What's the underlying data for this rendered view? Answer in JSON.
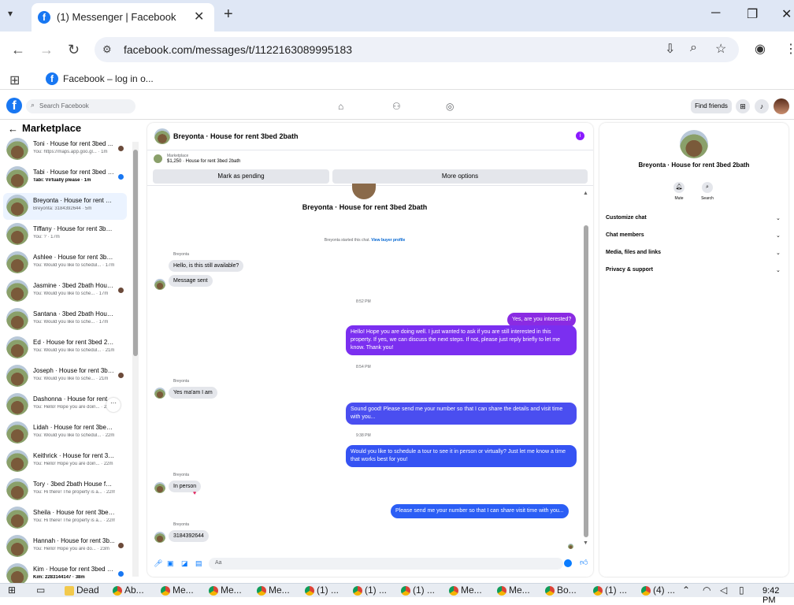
{
  "browser": {
    "tab_title": "(1) Messenger | Facebook",
    "url": "facebook.com/messages/t/1122163089995183",
    "bookmark": "Facebook – log in o..."
  },
  "fb": {
    "search_placeholder": "Search Facebook",
    "find_friends": "Find friends"
  },
  "left": {
    "title": "Marketplace",
    "conversations": [
      {
        "name": "Toni · House for rent 3bed ...",
        "preview": "You: https://maps.app.goo.gl... · 1m",
        "indicator": "avatar"
      },
      {
        "name": "Tabi · House for rent 3bed 2...",
        "preview": "Tabi: Virtually please · 1m",
        "indicator": "unread",
        "bold": true
      },
      {
        "name": "Breyonta · House for rent 3be...",
        "preview": "Breyonta: 3184392644 · 5m",
        "indicator": "",
        "selected": true
      },
      {
        "name": "Tiffany · House for rent 3bed ...",
        "preview": "You: ? · 17m",
        "indicator": ""
      },
      {
        "name": "Ashlee · House for rent 3bed ...",
        "preview": "You: Would you like to schedul... · 17m",
        "indicator": ""
      },
      {
        "name": "Jasmine · 3bed 2bath Hous...",
        "preview": "You: Would you like to sche... · 17m",
        "indicator": "avatar"
      },
      {
        "name": "Santana · 3bed 2bath House f...",
        "preview": "You: Would you like to sche... · 17m",
        "indicator": ""
      },
      {
        "name": "Ed · House for rent 3bed 2bath",
        "preview": "You: Would you like to schedul... · 21m",
        "indicator": ""
      },
      {
        "name": "Joseph · House for rent 3be...",
        "preview": "You: Would you like to sche... · 21m",
        "indicator": "avatar"
      },
      {
        "name": "Dashonna · House for rent ...",
        "preview": "You: Hello! Hope you are doin... · 21m",
        "indicator": "more"
      },
      {
        "name": "Lidah · House for rent 3bed 2...",
        "preview": "You: Would you like to schedul... · 22m",
        "indicator": ""
      },
      {
        "name": "Keithrick · House for rent 3be...",
        "preview": "You: Hello! Hope you are doin... · 22m",
        "indicator": ""
      },
      {
        "name": "Tory · 3bed 2bath House for r...",
        "preview": "You: Hi there! The property is a... · 22m",
        "indicator": ""
      },
      {
        "name": "Sheila · House for rent 3bed 2...",
        "preview": "You: Hi there! The property is a... · 22m",
        "indicator": ""
      },
      {
        "name": "Hannah · House for rent 3b...",
        "preview": "You: Hello! Hope you are do... · 23m",
        "indicator": "avatar"
      },
      {
        "name": "Kim · House for rent 3bed 2...",
        "preview": "Kim: 2283144147 · 38m",
        "indicator": "unread",
        "bold": true
      }
    ]
  },
  "chat": {
    "header_name": "Breyonta · House for rent 3bed 2bath",
    "marketplace_label": "Marketplace",
    "listing": "$1,250 · House for rent 3bed 2bath",
    "mark_pending": "Mark as pending",
    "more_options": "More options",
    "thread_title": "Breyonta · House for rent 3bed 2bath",
    "started": "Breyonta started this chat.",
    "view_profile": "View buyer profile",
    "sender": "Breyonta",
    "msg1": "Hello, is this still available?",
    "msg2": "Message sent",
    "ts1": "8:52 PM",
    "out1": "Yes, are you interested?",
    "out2": "Hello! Hope you are doing well. I just wanted to ask if you are still interested in this property. If yes, we can discuss the next steps. If not, please just reply briefly to let me know. Thank you!",
    "ts2": "8:54 PM",
    "msg3": "Yes ma'am I am",
    "out3": "Sound good! Please send me your number so that I can share the details and visit time with you...",
    "ts3": "9:38 PM",
    "out4": "Would you like to schedule a tour to see it in person or virtually? Just let me know a time that works best for you!",
    "msg4": "In person",
    "out5": "Please send me your number so that I can share visit time with you...",
    "msg5": "3184392644",
    "composer_placeholder": "Aa"
  },
  "right": {
    "name": "Breyonta · House for rent 3bed 2bath",
    "mute": "Mute",
    "search": "Search",
    "rows": [
      "Customize chat",
      "Chat members",
      "Media, files and links",
      "Privacy & support"
    ]
  },
  "taskbar": {
    "items": [
      "Dead",
      "Ab...",
      "Me...",
      "Me...",
      "Me...",
      "(1) ...",
      "(1) ...",
      "(1) ...",
      "Me...",
      "Me...",
      "Bo...",
      "(1) ...",
      "(4) ..."
    ],
    "clock": "9:42 PM"
  },
  "colors": {
    "purple": "#8a2be2",
    "blue": "#2b5ef5",
    "fb_blue": "#1877f2"
  }
}
